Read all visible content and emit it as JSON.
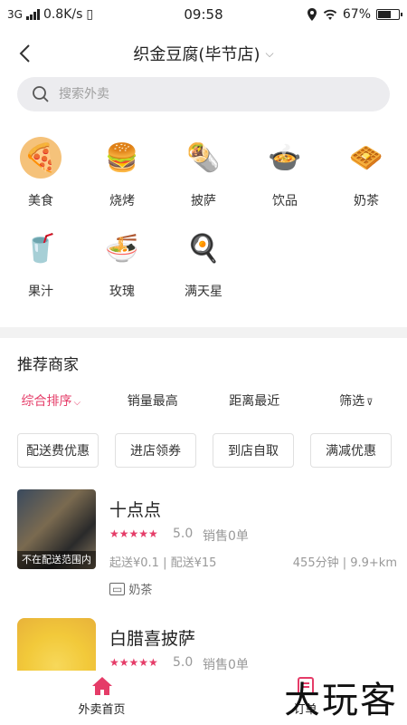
{
  "status_bar": {
    "network": "3G",
    "speed": "0.8K/s",
    "time": "09:58",
    "battery": "67%",
    "battery_level": 0.67
  },
  "header": {
    "title": "织金豆腐(毕节店)"
  },
  "search": {
    "placeholder": "搜索外卖"
  },
  "categories": [
    {
      "label": "美食",
      "icon": "pizza-icon"
    },
    {
      "label": "烧烤",
      "icon": "burger-icon"
    },
    {
      "label": "披萨",
      "icon": "wrap-icon"
    },
    {
      "label": "饮品",
      "icon": "stew-icon"
    },
    {
      "label": "奶茶",
      "icon": "waffle-icon"
    },
    {
      "label": "果汁",
      "icon": "milkshake-icon"
    },
    {
      "label": "玫瑰",
      "icon": "noodle-bowl-icon"
    },
    {
      "label": "满天星",
      "icon": "fried-egg-pan-icon"
    }
  ],
  "recommended": {
    "title": "推荐商家",
    "sort": [
      {
        "label": "综合排序",
        "active": true
      },
      {
        "label": "销量最高",
        "active": false
      },
      {
        "label": "距离最近",
        "active": false
      },
      {
        "label": "筛选",
        "active": false
      }
    ],
    "filters": [
      "配送费优惠",
      "进店领券",
      "到店自取",
      "满减优惠"
    ],
    "shops": [
      {
        "name": "十点点",
        "rating": "5.0",
        "sales": "销售0单",
        "fees": "起送¥0.1 | 配送¥15",
        "distance": "455分钟 | 9.9+km",
        "tag": "奶茶",
        "overlay": "不在配送范围内"
      },
      {
        "name": "白腊喜披萨",
        "rating": "5.0",
        "sales": "销售0单"
      }
    ]
  },
  "tabbar": {
    "home": "外卖首页",
    "orders": "订单"
  },
  "watermark": "大玩客",
  "colors": {
    "accent": "#e53c68"
  }
}
